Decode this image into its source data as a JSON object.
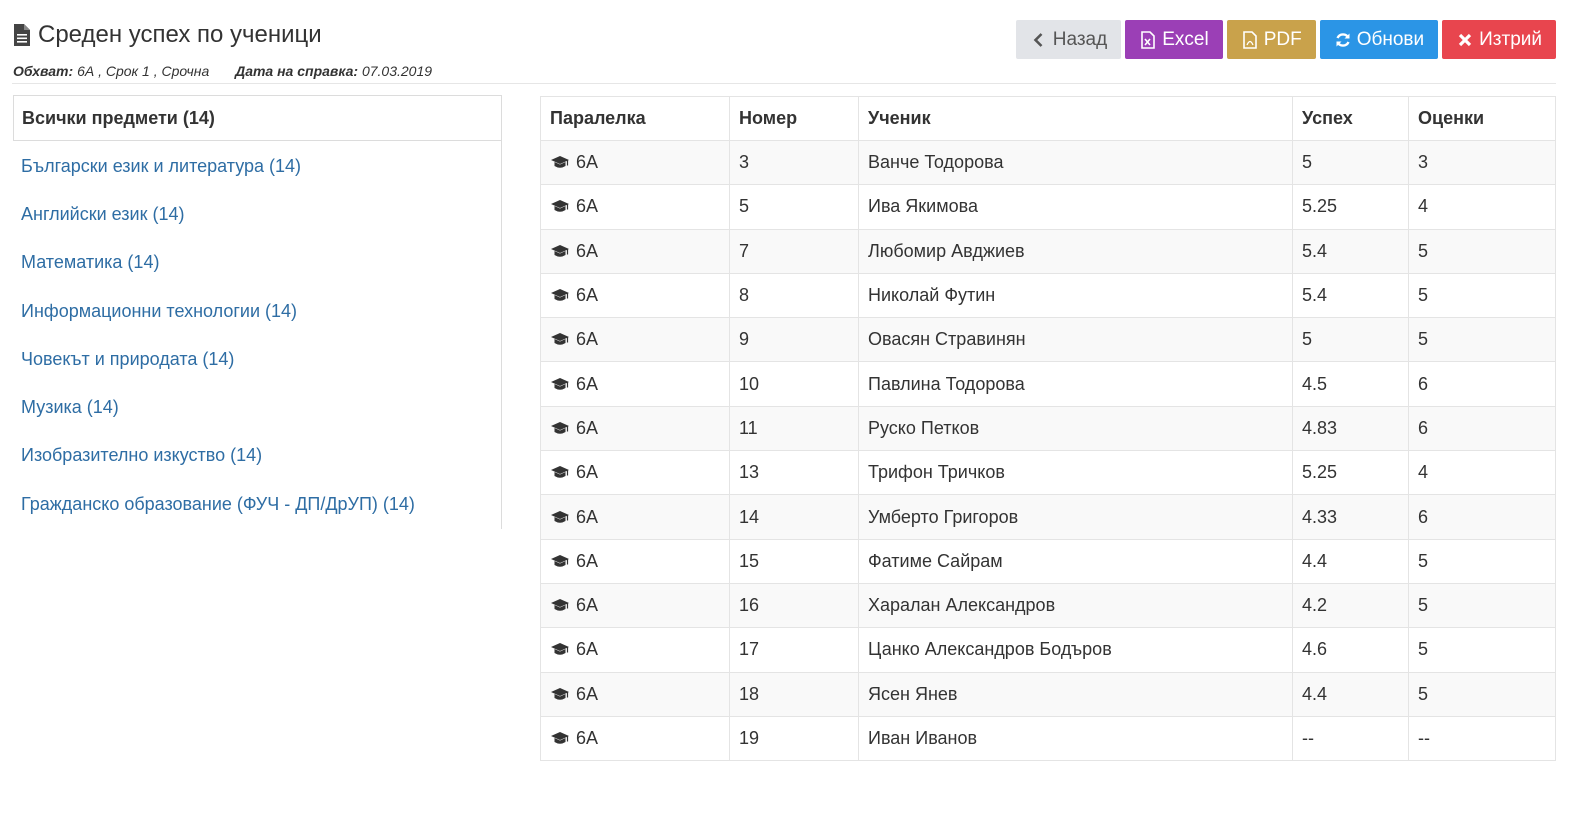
{
  "header": {
    "title": "Среден успех по ученици",
    "scope_label": "Обхват:",
    "scope_value": "6А , Срок 1 , Срочна",
    "date_label": "Дата на справка:",
    "date_value": "07.03.2019"
  },
  "toolbar": {
    "back_label": "Назад",
    "excel_label": "Excel",
    "pdf_label": "PDF",
    "refresh_label": "Обнови",
    "delete_label": "Изтрий"
  },
  "sidebar": {
    "items": [
      {
        "label": "Всички предмети (14)"
      },
      {
        "label": "Български език и литература (14)"
      },
      {
        "label": "Английски език (14)"
      },
      {
        "label": "Математика (14)"
      },
      {
        "label": "Информационни технологии (14)"
      },
      {
        "label": "Човекът и природата (14)"
      },
      {
        "label": "Музика (14)"
      },
      {
        "label": "Изобразително изкуство (14)"
      },
      {
        "label": "Гражданско образование (ФУЧ - ДП/ДрУП) (14)"
      }
    ]
  },
  "table": {
    "headers": [
      "Паралелка",
      "Номер",
      "Ученик",
      "Успех",
      "Оценки"
    ],
    "rows": [
      [
        "6А",
        "3",
        "Ванче Тодорова",
        "5",
        "3"
      ],
      [
        "6А",
        "5",
        "Ива Якимова",
        "5.25",
        "4"
      ],
      [
        "6А",
        "7",
        "Любомир Авджиев",
        "5.4",
        "5"
      ],
      [
        "6А",
        "8",
        "Николай Футин",
        "5.4",
        "5"
      ],
      [
        "6А",
        "9",
        "Овасян Стравинян",
        "5",
        "5"
      ],
      [
        "6А",
        "10",
        "Павлина Тодорова",
        "4.5",
        "6"
      ],
      [
        "6А",
        "11",
        "Руско Петков",
        "4.83",
        "6"
      ],
      [
        "6А",
        "13",
        "Трифон Тричков",
        "5.25",
        "4"
      ],
      [
        "6А",
        "14",
        "Умберто Григоров",
        "4.33",
        "6"
      ],
      [
        "6А",
        "15",
        "Фатиме Сайрам",
        "4.4",
        "5"
      ],
      [
        "6А",
        "16",
        "Харалан Александров",
        "4.2",
        "5"
      ],
      [
        "6А",
        "17",
        "Цанко Александров Бодъров",
        "4.6",
        "5"
      ],
      [
        "6А",
        "18",
        "Ясен Янев",
        "4.4",
        "5"
      ],
      [
        "6А",
        "19",
        "Иван Иванов",
        "--",
        "--"
      ]
    ]
  },
  "icons": {
    "title": "document-icon",
    "back": "chevron-left-icon",
    "excel": "excel-file-icon",
    "pdf": "pdf-file-icon",
    "refresh": "refresh-icon",
    "delete": "close-icon",
    "class": "graduation-cap-icon"
  }
}
